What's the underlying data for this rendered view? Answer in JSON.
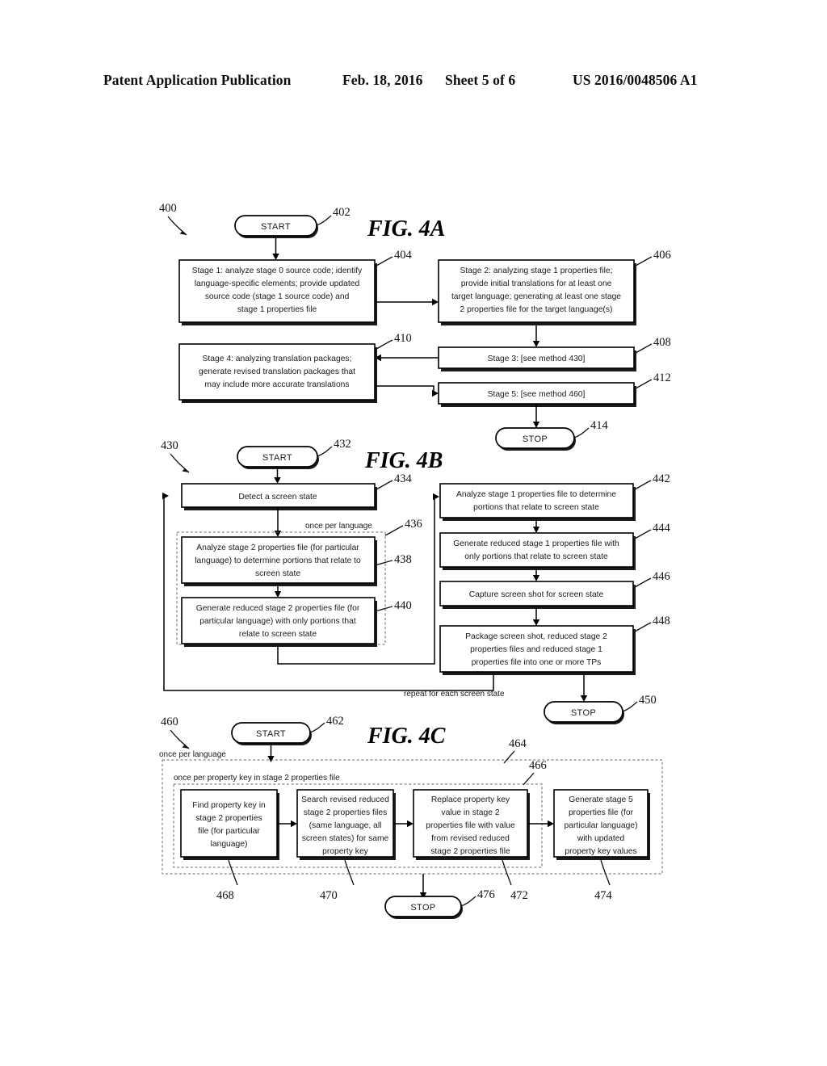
{
  "header": {
    "publication": "Patent Application Publication",
    "date": "Feb. 18, 2016",
    "sheet": "Sheet 5 of 6",
    "number": "US 2016/0048506 A1"
  },
  "figures": [
    {
      "id": "fig4a",
      "label": "FIG. 4A",
      "method_ref": "400",
      "nodes": [
        {
          "ref": "402",
          "type": "terminator",
          "text": "START"
        },
        {
          "ref": "404",
          "type": "process",
          "text": "Stage 1: analyze stage 0 source code; identify language-specific elements; provide updated source code (stage 1 source code) and stage 1 properties file"
        },
        {
          "ref": "406",
          "type": "process",
          "text": "Stage 2: analyzing stage 1 properties file; provide initial translations for at least one target language; generating at least one stage 2 properties file for the target language(s)"
        },
        {
          "ref": "408",
          "type": "process",
          "text": "Stage 3: [see method 430]"
        },
        {
          "ref": "410",
          "type": "process",
          "text": "Stage 4: analyzing translation packages; generate revised translation packages that may include more accurate translations"
        },
        {
          "ref": "412",
          "type": "process",
          "text": "Stage 5: [see method 460]"
        },
        {
          "ref": "414",
          "type": "terminator",
          "text": "STOP"
        }
      ]
    },
    {
      "id": "fig4b",
      "label": "FIG. 4B",
      "method_ref": "430",
      "annotations": [
        {
          "ref": "436",
          "text": "once per language"
        },
        {
          "ref": "",
          "text": "repeat for each screen state"
        }
      ],
      "nodes": [
        {
          "ref": "432",
          "type": "terminator",
          "text": "START"
        },
        {
          "ref": "434",
          "type": "process",
          "text": "Detect a screen state"
        },
        {
          "ref": "438",
          "type": "process",
          "text": "Analyze stage 2 properties file (for particular language) to determine portions that relate to screen state"
        },
        {
          "ref": "440",
          "type": "process",
          "text": "Generate reduced stage 2 properties file (for particular language) with only portions that relate to screen state"
        },
        {
          "ref": "442",
          "type": "process",
          "text": "Analyze stage 1 properties file to determine portions that relate to screen state"
        },
        {
          "ref": "444",
          "type": "process",
          "text": "Generate reduced stage 1 properties file with only portions that relate to screen state"
        },
        {
          "ref": "446",
          "type": "process",
          "text": "Capture screen shot for screen state"
        },
        {
          "ref": "448",
          "type": "process",
          "text": "Package screen shot, reduced stage 2 properties files and reduced stage 1 properties file into one or more TPs"
        },
        {
          "ref": "450",
          "type": "terminator",
          "text": "STOP"
        }
      ]
    },
    {
      "id": "fig4c",
      "label": "FIG. 4C",
      "method_ref": "460",
      "annotations": [
        {
          "ref": "464",
          "text": "once per language"
        },
        {
          "ref": "466",
          "text": "once per property key in stage 2 properties file"
        }
      ],
      "nodes": [
        {
          "ref": "462",
          "type": "terminator",
          "text": "START"
        },
        {
          "ref": "468",
          "type": "process",
          "text": "Find property key in stage 2 properties file (for particular language)"
        },
        {
          "ref": "470",
          "type": "process",
          "text": "Search revised reduced stage 2 properties files (same language, all screen states) for same property key"
        },
        {
          "ref": "472",
          "type": "process",
          "text": "Replace property key value in stage 2 properties file with value from revised reduced stage 2 properties file"
        },
        {
          "ref": "474",
          "type": "process",
          "text": "Generate stage 5 properties file (for particular language) with updated property key values"
        },
        {
          "ref": "476",
          "type": "terminator",
          "text": "STOP"
        }
      ]
    }
  ]
}
